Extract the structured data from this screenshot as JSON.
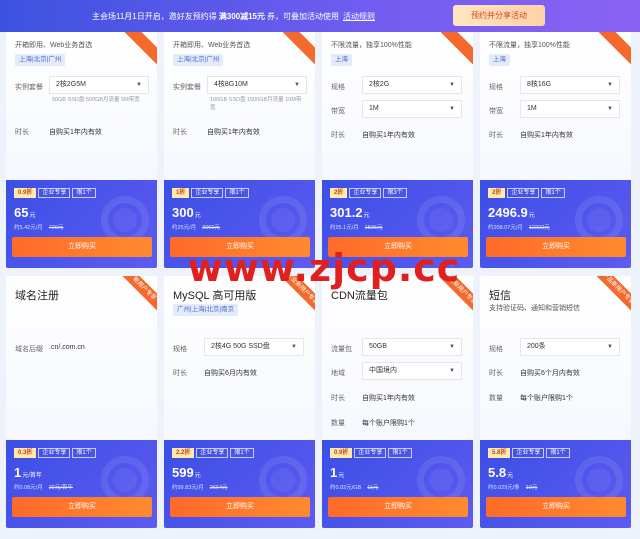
{
  "banner": {
    "text_before": "主会场11月1日开启，邀好友预约得",
    "highlight": "满300减15元",
    "text_after": "券，可叠加活动使用",
    "link": "活动规则",
    "button": "预约并分享活动"
  },
  "watermark": "www.zjcp.cc",
  "cards": [
    {
      "title": "",
      "desc": "开箱即用、Web业务首选",
      "region": "上海|北京|广州",
      "ribbon": "",
      "row1_label": "实例套餐",
      "row1_value": "2核2G5M",
      "row1_sub": "50GB SSD盘 500GB月流量 5M带宽",
      "row2_label": "时长",
      "row2_value": "自购买1年内有效",
      "discount": "0.9折",
      "badge_a": "企业专享",
      "badge_b": "限1个",
      "price": "65",
      "unit": "元",
      "per": "约5.42元/月",
      "orig": "720元",
      "buy": "立即购买"
    },
    {
      "title": "",
      "desc": "开箱即用、Web业务首选",
      "region": "上海|北京|广州",
      "ribbon": "",
      "row1_label": "实例套餐",
      "row1_value": "4核8G10M",
      "row1_sub": "100GB SSD盘 1500GB月流量 10M带宽",
      "row2_label": "时长",
      "row2_value": "自购买1年内有效",
      "discount": "1折",
      "badge_a": "企业专享",
      "badge_b": "限1个",
      "price": "300",
      "unit": "元",
      "per": "约25元/月",
      "orig": "3060元",
      "buy": "立即购买"
    },
    {
      "title": "",
      "desc": "不限流量，独享100%性能",
      "region": "上海",
      "ribbon": "",
      "row1_label": "规格",
      "row1_value": "2核2G",
      "row2_label": "带宽",
      "row2_value": "1M",
      "row3_label": "时长",
      "row3_value": "自购买1年内有效",
      "discount": "2折",
      "badge_a": "企业专享",
      "badge_b": "限3个",
      "price": "301.2",
      "unit": "元",
      "per": "约25.1元/月",
      "orig": "1506元",
      "buy": "立即购买"
    },
    {
      "title": "",
      "desc": "不限流量，独享100%性能",
      "region": "上海",
      "ribbon": "",
      "row1_label": "规格",
      "row1_value": "8核16G",
      "row2_label": "带宽",
      "row2_value": "1M",
      "row3_label": "时长",
      "row3_value": "自购买1年内有效",
      "discount": "2折",
      "badge_a": "企业专享",
      "badge_b": "限1个",
      "price": "2496.9",
      "unit": "元",
      "per": "约208.07元/月",
      "orig": "12222元",
      "buy": "立即购买"
    },
    {
      "title": "域名注册",
      "ribbon": "新用户专享",
      "row1_label": "域名后缀",
      "row1_value": ".cn/.com.cn",
      "discount": "0.3折",
      "badge_a": "企业专享",
      "badge_b": "限1个",
      "price": "1",
      "unit": "元/首年",
      "per": "约0.08元/月",
      "orig": "29元/首年",
      "buy": "立即购买"
    },
    {
      "title": "MySQL 高可用版",
      "region": "广州|上海|北京|南京",
      "ribbon": "企业新用户专享",
      "row1_label": "规格",
      "row1_value": "2核4G 50G SSD盘",
      "row2_label": "时长",
      "row2_value": "自购买6月内有效",
      "discount": "2.2折",
      "badge_a": "企业专享",
      "badge_b": "限1个",
      "price": "599",
      "unit": "元",
      "per": "约99.83元/月",
      "orig": "2664元",
      "buy": "立即购买"
    },
    {
      "title": "CDN流量包",
      "ribbon": "企业新用户专享",
      "row1_label": "流量包",
      "row1_value": "50GB",
      "row2_label": "地域",
      "row2_value": "中国境内",
      "row3_label": "时长",
      "row3_value": "自购买1年内有效",
      "row4_label": "数量",
      "row4_value": "每个账户限购1个",
      "discount": "0.9折",
      "badge_a": "企业专享",
      "badge_b": "限1个",
      "price": "1",
      "unit": "元",
      "per": "约0.02元/GB",
      "orig": "11元",
      "buy": "立即购买"
    },
    {
      "title": "短信",
      "desc": "支持验证码、通知和营销短信",
      "ribbon": "产品新用户专享",
      "row1_label": "规格",
      "row1_value": "200条",
      "row2_label": "时长",
      "row2_value": "自购买6个月内有效",
      "row3_label": "数量",
      "row3_value": "每个账户限购1个",
      "discount": "5.8折",
      "badge_a": "企业专享",
      "badge_b": "限1个",
      "price": "5.8",
      "unit": "元",
      "per": "约0.029元/条",
      "orig": "10元",
      "buy": "立即购买"
    }
  ]
}
